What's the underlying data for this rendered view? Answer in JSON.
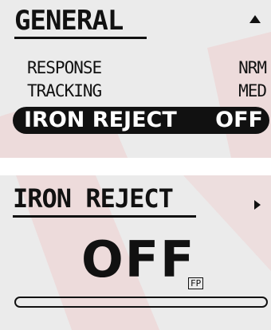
{
  "general_screen": {
    "title": "GENERAL",
    "scroll_icon": "triangle-up-icon",
    "items": [
      {
        "label": "RESPONSE",
        "value": "NRM"
      },
      {
        "label": "TRACKING",
        "value": "MED"
      },
      {
        "label": "IRON REJECT",
        "value": "OFF",
        "selected": true
      }
    ]
  },
  "detail_screen": {
    "title": "IRON REJECT",
    "nav_icon": "triangle-right-icon",
    "value": "OFF",
    "badge": "FP",
    "level_fraction": 0.0
  },
  "colors": {
    "screen_bg": "#ebebeb",
    "ink": "#111111",
    "watermark": "#e8a0a0"
  }
}
